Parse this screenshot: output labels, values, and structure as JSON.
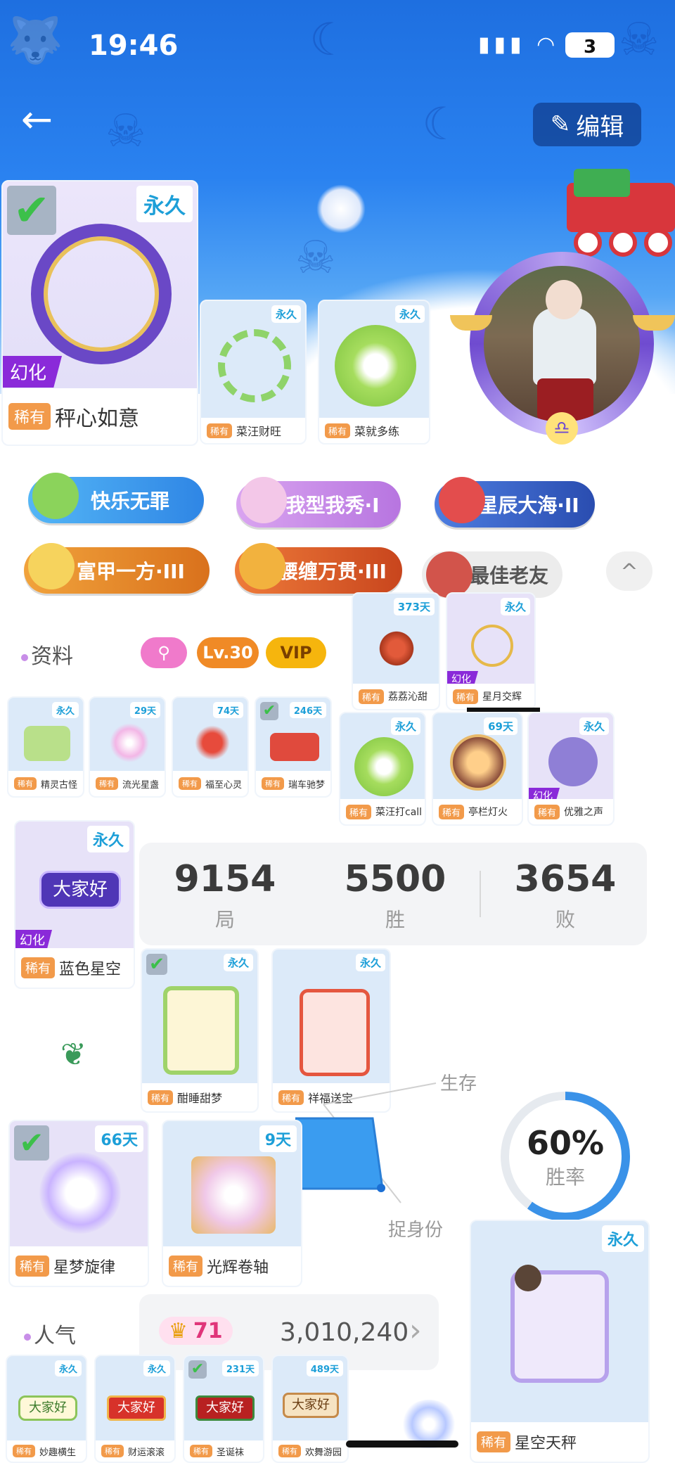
{
  "status_bar": {
    "time": "19:46",
    "signal_wifi": "▮▮▮ ◠",
    "battery": "3"
  },
  "header": {
    "back_icon": "←",
    "edit_label": "编辑",
    "edit_icon": "✎"
  },
  "featured_frame": {
    "duration": "永久",
    "tag": "稀有",
    "name": "秤心如意",
    "huanhua": "幻化",
    "checked": true
  },
  "frames_top": [
    {
      "duration": "永久",
      "tag": "稀有",
      "name": "菜汪财旺"
    },
    {
      "duration": "永久",
      "tag": "稀有",
      "name": "菜就多练"
    }
  ],
  "badges": [
    {
      "label": "快乐无罪",
      "color": "#3aa0f0"
    },
    {
      "label": "我型我秀·I",
      "color": "#c07be0"
    },
    {
      "label": "星辰大海·II",
      "color": "#3a5fc8"
    },
    {
      "label": "富甲一方·III",
      "color": "#e2871f"
    },
    {
      "label": "腰缠万贯·III",
      "color": "#d9531e"
    },
    {
      "label": "最佳老友",
      "color": "#ececec"
    }
  ],
  "collapse_icon": "^",
  "profile": {
    "title": "资料",
    "search_icon": "⚲",
    "level": "Lv.30",
    "vip": "VIP"
  },
  "items_row_a": [
    {
      "duration": "373天",
      "tag": "稀有",
      "name": "荔荔沁甜"
    },
    {
      "duration": "永久",
      "tag": "稀有",
      "name": "星月交辉",
      "huanhua": "幻化"
    }
  ],
  "items_row_b": [
    {
      "duration": "永久",
      "tag": "稀有",
      "name": "精灵古怪"
    },
    {
      "duration": "29天",
      "tag": "稀有",
      "name": "流光星盏"
    },
    {
      "duration": "74天",
      "tag": "稀有",
      "name": "福至心灵"
    },
    {
      "duration": "246天",
      "tag": "稀有",
      "name": "瑞车驰梦",
      "checked": true
    }
  ],
  "items_row_c": [
    {
      "duration": "永久",
      "tag": "稀有",
      "name": "菜汪打call"
    },
    {
      "duration": "69天",
      "tag": "稀有",
      "name": "亭栏灯火"
    },
    {
      "duration": "永久",
      "tag": "稀有",
      "name": "优雅之声",
      "huanhua": "幻化"
    }
  ],
  "bubble_card": {
    "duration": "永久",
    "tag": "稀有",
    "name": "蓝色星空",
    "huanhua": "幻化",
    "bubble_text": "大家好"
  },
  "stats": {
    "games": "9154",
    "games_label": "局",
    "wins": "5500",
    "wins_label": "胜",
    "losses": "3654",
    "losses_label": "败"
  },
  "cards_mid": [
    {
      "duration": "永久",
      "tag": "稀有",
      "name": "酣睡甜梦",
      "checked": true
    },
    {
      "duration": "永久",
      "tag": "稀有",
      "name": "祥福送宝"
    }
  ],
  "radar_labels": {
    "survive": "生存",
    "identity": "捉身份"
  },
  "win_rate": {
    "percent": "60%",
    "label": "胜率",
    "value": 0.6
  },
  "cards_lower": [
    {
      "duration": "66天",
      "tag": "稀有",
      "name": "星梦旋律",
      "checked": true
    },
    {
      "duration": "9天",
      "tag": "稀有",
      "name": "光辉卷轴"
    }
  ],
  "popularity": {
    "title": "人气",
    "crown_icon": "♛",
    "crown_count": "71",
    "score": "3,010,240",
    "chevron": "›"
  },
  "right_card": {
    "duration": "永久",
    "tag": "稀有",
    "name": "星空天秤"
  },
  "bubbles_bottom": [
    {
      "duration": "永久",
      "tag": "稀有",
      "name": "妙趣横生",
      "bubble_text": "大家好"
    },
    {
      "duration": "永久",
      "tag": "稀有",
      "name": "财运滚滚",
      "bubble_text": "大家好"
    },
    {
      "duration": "231天",
      "tag": "稀有",
      "name": "圣诞袜",
      "bubble_text": "大家好",
      "checked": true
    },
    {
      "duration": "489天",
      "tag": "稀有",
      "name": "欢舞游园",
      "bubble_text": "大家好"
    }
  ]
}
